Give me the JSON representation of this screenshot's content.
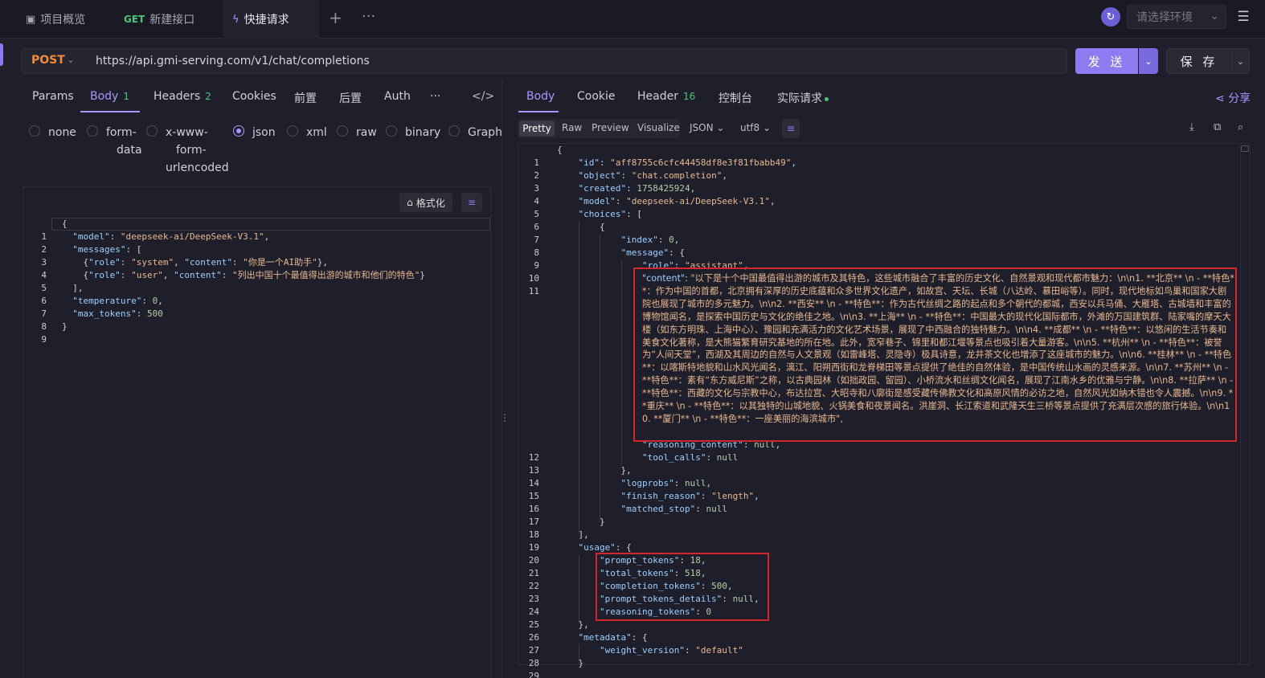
{
  "tabs": [
    {
      "label": "项目概览",
      "icon": "dashboard-icon"
    },
    {
      "method": "GET",
      "label": "新建接口"
    },
    {
      "label": "快捷请求",
      "icon": "lightning-icon"
    }
  ],
  "env": {
    "placeholder": "请选择环境"
  },
  "request": {
    "method": "POST",
    "url": "https://api.gmi-serving.com/v1/chat/completions",
    "send_label": "发 送",
    "save_label": "保 存"
  },
  "req_tabs": {
    "params": "Params",
    "body": "Body",
    "body_count": "1",
    "headers": "Headers",
    "headers_count": "2",
    "cookies": "Cookies",
    "pre": "前置",
    "post": "后置",
    "auth": "Auth",
    "more": "···"
  },
  "body_types": {
    "none": "none",
    "form_data": [
      "form-",
      "data"
    ],
    "urlencoded": [
      "x-www-",
      "form-",
      "urlencoded"
    ],
    "json": "json",
    "xml": "xml",
    "raw": "raw",
    "binary": "binary",
    "graphql": "GraphQ",
    "selected": "json"
  },
  "format_label": "格式化",
  "req_body_lines": [
    [
      "1",
      "{"
    ],
    [
      "2",
      "  \"model\": \"deepseek-ai/DeepSeek-V3.1\","
    ],
    [
      "3",
      "  \"messages\": ["
    ],
    [
      "4",
      "    {\"role\": \"system\", \"content\": \"你是一个AI助手\"},"
    ],
    [
      "5",
      "    {\"role\": \"user\", \"content\": \"列出中国十个最值得出游的城市和他们的特色\"}"
    ],
    [
      "6",
      "  ],"
    ],
    [
      "7",
      "  \"temperature\": 0,"
    ],
    [
      "8",
      "  \"max_tokens\": 500"
    ],
    [
      "9",
      "}"
    ]
  ],
  "res_tabs": {
    "body": "Body",
    "cookie": "Cookie",
    "header": "Header",
    "header_count": "16",
    "console": "控制台",
    "actual": "实际请求",
    "share": "分享"
  },
  "view": {
    "options": [
      "Pretty",
      "Raw",
      "Preview",
      "Visualize"
    ],
    "selected": "Pretty",
    "format": "JSON",
    "encoding": "utf8"
  },
  "response": {
    "id": "aff8755c6cfc44458df8e3f81fbabb49",
    "object": "chat.completion",
    "created": "1758425924",
    "model": "deepseek-ai/DeepSeek-V3.1",
    "index": "0",
    "role": "assistant",
    "content": "以下是十个中国最值得出游的城市及其特色，这些城市融合了丰富的历史文化、自然景观和现代都市魅力：\\n\\n1. **北京**  \\n   - **特色**：作为中国的首都，北京拥有深厚的历史底蕴和众多世界文化遗产，如故宫、天坛、长城（八达岭、慕田峪等）。同时，现代地标如鸟巢和国家大剧院也展现了城市的多元魅力。\\n\\n2. **西安**  \\n   - **特色**：作为古代丝绸之路的起点和多个朝代的都城，西安以兵马俑、大雁塔、古城墙和丰富的博物馆闻名，是探索中国历史与文化的绝佳之地。\\n\\n3. **上海**  \\n   - **特色**：中国最大的现代化国际都市，外滩的万国建筑群、陆家嘴的摩天大楼（如东方明珠、上海中心）、豫园和充满活力的文化艺术场景，展现了中西融合的独特魅力。\\n\\n4. **成都**  \\n   - **特色**：以悠闲的生活节奏和美食文化著称，是大熊猫繁育研究基地的所在地。此外，宽窄巷子、锦里和都江堰等景点也吸引着大量游客。\\n\\n5. **杭州**  \\n   - **特色**：被誉为“人间天堂”，西湖及其周边的自然与人文景观（如雷峰塔、灵隐寺）极具诗意，龙井茶文化也增添了这座城市的魅力。\\n\\n6. **桂林**  \\n   - **特色**：以喀斯特地貌和山水风光闻名，漓江、阳朔西街和龙脊梯田等景点提供了绝佳的自然体验，是中国传统山水画的灵感来源。\\n\\n7. **苏州**  \\n   - **特色**：素有“东方威尼斯”之称，以古典园林（如拙政园、留园）、小桥流水和丝绸文化闻名，展现了江南水乡的优雅与宁静。\\n\\n8. **拉萨**  \\n   - **特色**：西藏的文化与宗教中心，布达拉宫、大昭寺和八廓街是感受藏传佛教文化和高原风情的必访之地，自然风光如纳木错也令人震撼。\\n\\n9. **重庆**  \\n   - **特色**：以其独特的山城地貌、火锅美食和夜景闻名。洪崖洞、长江索道和武隆天生三桥等景点提供了充满层次感的旅行体验。\\n\\n10. **厦门**  \\n   - **特色**：一座美丽的海滨城市",
    "finish_reason": "length",
    "prompt_tokens": "18",
    "total_tokens": "518",
    "completion_tokens": "500",
    "weight_version": "default",
    "null": "null"
  },
  "colors": {
    "accent": "#a599ff",
    "send": "#8c7cf0",
    "method_post": "#ef8c3c",
    "badge": "#4ec27a",
    "highlight": "#d4262f"
  }
}
